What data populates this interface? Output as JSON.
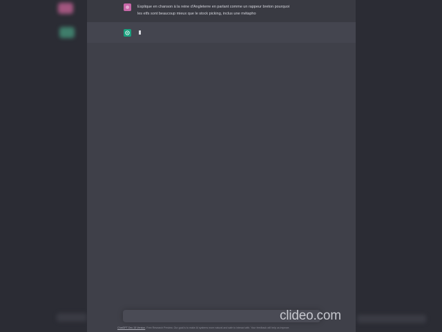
{
  "conversation": {
    "user_message": {
      "line1": "Explique en chanson à la reine d'Angleterre en parlant comme un rappeur breton pourquoi",
      "line2": "les etfs sont beaucoup mieux que le stock picking, inclus une métapho"
    },
    "assistant_message": {
      "streaming_cursor": "▮"
    }
  },
  "footer": {
    "link_text": "ChatGPT Dec 15 Version",
    "text": ". Free Research Preview. Our goal is to make AI systems more natural and safe to interact with. Your feedback will help us improve."
  },
  "watermark": {
    "text": "clideo.com"
  },
  "colors": {
    "user_avatar": "#c768a8",
    "assistant_avatar": "#19a07e",
    "background": "#3f4049"
  },
  "icons": {
    "user_avatar": "user-avatar-icon",
    "assistant_avatar": "openai-logo-icon"
  }
}
